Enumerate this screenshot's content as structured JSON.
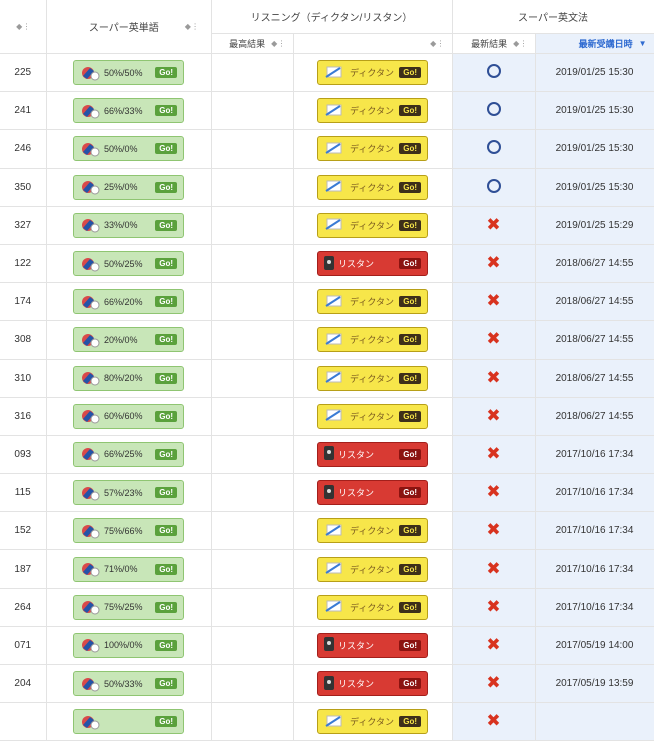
{
  "header": {
    "col_no_sort": "⬍",
    "super_eitan": "スーパー英単語",
    "listening": "リスニング（ディクタン/リスタン）",
    "super_grammar": "スーパー英文法",
    "best_result": "最高結果",
    "latest_result": "最新結果",
    "latest_date": "最新受講日時"
  },
  "buttons": {
    "go": "Go!",
    "dictan": "ディクタン",
    "listan": "リスタン"
  },
  "colors": {
    "accent_blue": "#2f6bd1",
    "cross_red": "#d8331f",
    "circle_navy": "#2f4f96"
  },
  "rows": [
    {
      "num": "225",
      "eitan": "50%/50%",
      "listening": "dictan",
      "result": "circle",
      "date": "2019/01/25 15:30"
    },
    {
      "num": "241",
      "eitan": "66%/33%",
      "listening": "dictan",
      "result": "circle",
      "date": "2019/01/25 15:30"
    },
    {
      "num": "246",
      "eitan": "50%/0%",
      "listening": "dictan",
      "result": "circle",
      "date": "2019/01/25 15:30"
    },
    {
      "num": "350",
      "eitan": "25%/0%",
      "listening": "dictan",
      "result": "circle",
      "date": "2019/01/25 15:30"
    },
    {
      "num": "327",
      "eitan": "33%/0%",
      "listening": "dictan",
      "result": "cross",
      "date": "2019/01/25 15:29"
    },
    {
      "num": "122",
      "eitan": "50%/25%",
      "listening": "listan",
      "result": "cross",
      "date": "2018/06/27 14:55"
    },
    {
      "num": "174",
      "eitan": "66%/20%",
      "listening": "dictan",
      "result": "cross",
      "date": "2018/06/27 14:55"
    },
    {
      "num": "308",
      "eitan": "20%/0%",
      "listening": "dictan",
      "result": "cross",
      "date": "2018/06/27 14:55"
    },
    {
      "num": "310",
      "eitan": "80%/20%",
      "listening": "dictan",
      "result": "cross",
      "date": "2018/06/27 14:55"
    },
    {
      "num": "316",
      "eitan": "60%/60%",
      "listening": "dictan",
      "result": "cross",
      "date": "2018/06/27 14:55"
    },
    {
      "num": "093",
      "eitan": "66%/25%",
      "listening": "listan",
      "result": "cross",
      "date": "2017/10/16 17:34"
    },
    {
      "num": "115",
      "eitan": "57%/23%",
      "listening": "listan",
      "result": "cross",
      "date": "2017/10/16 17:34"
    },
    {
      "num": "152",
      "eitan": "75%/66%",
      "listening": "dictan",
      "result": "cross",
      "date": "2017/10/16 17:34"
    },
    {
      "num": "187",
      "eitan": "71%/0%",
      "listening": "dictan",
      "result": "cross",
      "date": "2017/10/16 17:34"
    },
    {
      "num": "264",
      "eitan": "75%/25%",
      "listening": "dictan",
      "result": "cross",
      "date": "2017/10/16 17:34"
    },
    {
      "num": "071",
      "eitan": "100%/0%",
      "listening": "listan",
      "result": "cross",
      "date": "2017/05/19 14:00"
    },
    {
      "num": "204",
      "eitan": "50%/33%",
      "listening": "listan",
      "result": "cross",
      "date": "2017/05/19 13:59"
    },
    {
      "num": "",
      "eitan": "",
      "listening": "dictan",
      "result": "cross",
      "date": ""
    }
  ]
}
